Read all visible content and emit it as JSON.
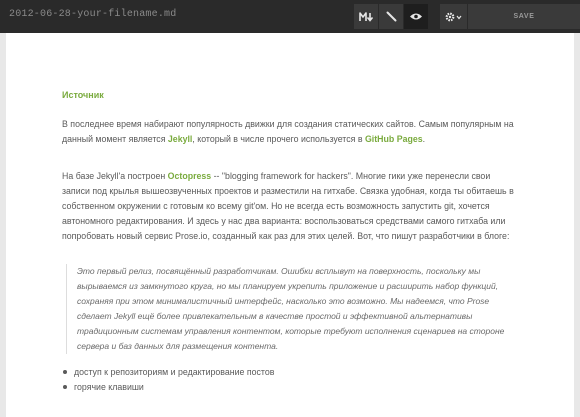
{
  "header": {
    "filename": "2012-06-28-your-filename.md",
    "save_label": "SAVE",
    "tools": [
      {
        "icon": "markdown-icon",
        "active": false
      },
      {
        "icon": "pencil-icon",
        "active": false
      },
      {
        "icon": "eye-icon",
        "active": true
      }
    ]
  },
  "doc": {
    "heading": "Источник",
    "p1": {
      "a": "В последнее время набирают популярность движки для создания статических сайтов. Самым популярным на данный момент является ",
      "link1": "Jekyll",
      "b": ", который в числе прочего используется в ",
      "link2": "GitHub Pages",
      "c": "."
    },
    "p2": {
      "a": "На базе Jekyll'а построен ",
      "link": "Octopress",
      "b": " -- \"blogging framework for hackers\". Многие гики уже перенесли свои записи под крылья вышеозвученных проектов и разместили на гитхабе. Связка удобная, когда ты обитаешь в собственном окружении с готовым ко всему git'ом. Но не всегда есть возможность запустить git, хочется автономного редактирования. И здесь у нас два варианта: воспользоваться средствами самого гитхаба или попробовать новый сервис Prose.io, созданный как раз для этих целей. Вот, что пишут разработчики в блоге:"
    },
    "quote": "Это первый релиз, посвящённый разработчикам. Ошибки всплывут на поверхность, поскольку мы вырываемся из замкнутого круга, но мы планируем укрепить приложение и расширить набор функций, сохраняя при этом минималистичный интерфейс, насколько это возможно. Мы надеемся, что Prose сделает Jekyll ещё более привлекательным в качестве простой и эффективной альтернативы традиционным системам управления контентом, которые требуют исполнения сценариев на стороне сервера и баз данных для размещения контента.",
    "list": [
      "доступ к репозиториям и редактирование постов",
      "горячие клавиши"
    ]
  },
  "colors": {
    "topbar": "#2a2a2a",
    "accent_link": "#7aab3e",
    "body_text": "#5a5a5a"
  }
}
